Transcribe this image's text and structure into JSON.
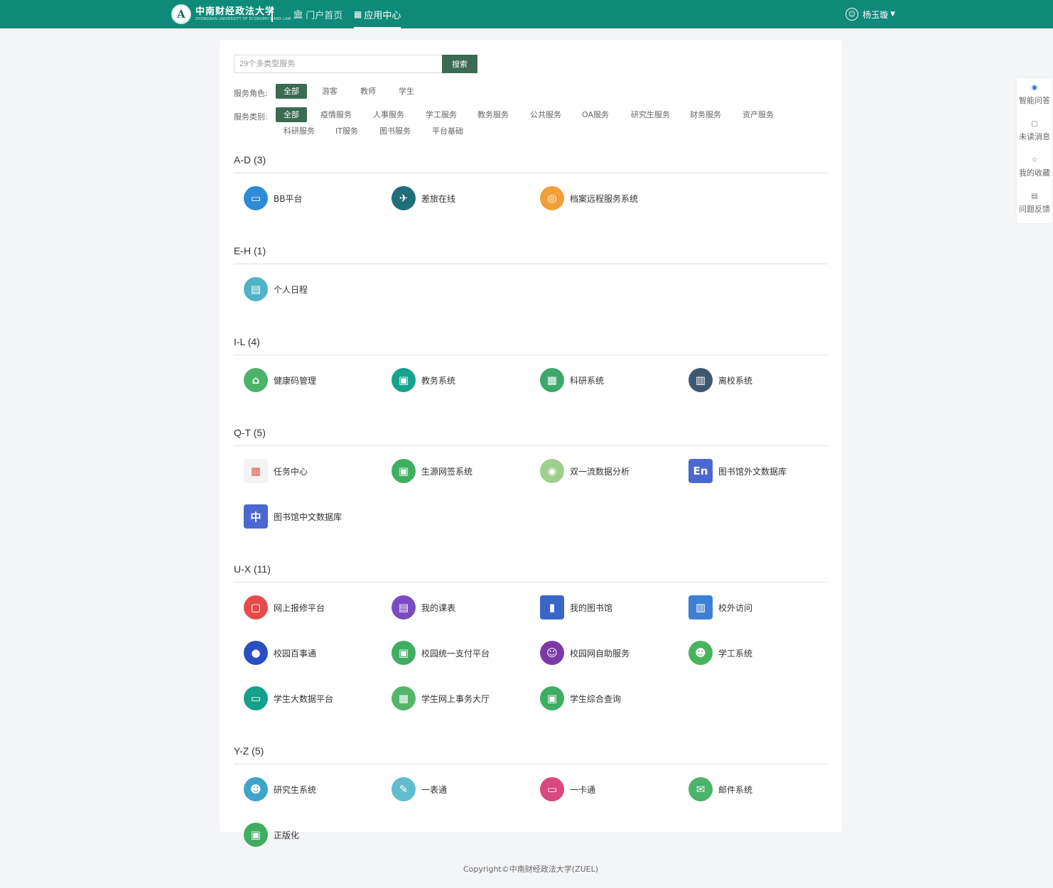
{
  "header": {
    "logo_cn": "中南财经政法大学",
    "logo_en": "ZHONGNAN UNIVERSITY OF ECONOMICS AND LAW",
    "nav": [
      {
        "label": "门户首页",
        "icon": "bank-icon"
      },
      {
        "label": "应用中心",
        "icon": "app-center-icon"
      }
    ],
    "user_name": "杨玉璇"
  },
  "search": {
    "placeholder": "29个多类型服务",
    "button": "搜索"
  },
  "filters": {
    "role_label": "服务角色:",
    "roles": [
      "全部",
      "游客",
      "教师",
      "学生"
    ],
    "category_label": "服务类别:",
    "categories": [
      "全部",
      "疫情服务",
      "人事服务",
      "学工服务",
      "教务服务",
      "公共服务",
      "OA服务",
      "研究生服务",
      "财务服务",
      "资产服务",
      "科研服务",
      "IT服务",
      "图书服务",
      "平台基础"
    ]
  },
  "sections": [
    {
      "title": "A-D (3)",
      "apps": [
        {
          "name": "BB平台",
          "color": "#2e8bd6",
          "glyph": "▭"
        },
        {
          "name": "差旅在线",
          "color": "#1f6e7a",
          "glyph": "✈"
        },
        {
          "name": "档案远程服务系统",
          "color": "#f2a03a",
          "glyph": "◎"
        }
      ]
    },
    {
      "title": "E-H (1)",
      "apps": [
        {
          "name": "个人日程",
          "color": "#4fb3c8",
          "glyph": "▤"
        }
      ]
    },
    {
      "title": "I-L (4)",
      "apps": [
        {
          "name": "健康码管理",
          "color": "#4cb36a",
          "glyph": "⌂"
        },
        {
          "name": "教务系统",
          "color": "#16a38c",
          "glyph": "▣"
        },
        {
          "name": "科研系统",
          "color": "#3ea86a",
          "glyph": "▦"
        },
        {
          "name": "离校系统",
          "color": "#3f5872",
          "glyph": "▥"
        }
      ]
    },
    {
      "title": "Q-T (5)",
      "apps": [
        {
          "name": "任务中心",
          "color": "#f3f3f3",
          "glyph": "▦",
          "square": true,
          "fg": "#e0574b"
        },
        {
          "name": "生源网签系统",
          "color": "#3fae62",
          "glyph": "▣"
        },
        {
          "name": "双一流数据分析",
          "color": "#9fcf8c",
          "glyph": "◉"
        },
        {
          "name": "图书馆外文数据库",
          "color": "#4b67d1",
          "glyph": "En",
          "square": true
        },
        {
          "name": "图书馆中文数据库",
          "color": "#4b67d1",
          "glyph": "中",
          "square": true
        }
      ]
    },
    {
      "title": "U-X (11)",
      "apps": [
        {
          "name": "网上报修平台",
          "color": "#e54b4b",
          "glyph": "▢"
        },
        {
          "name": "我的课表",
          "color": "#7a4bc1",
          "glyph": "▤"
        },
        {
          "name": "我的图书馆",
          "color": "#3a66c8",
          "glyph": "▮",
          "square": true
        },
        {
          "name": "校外访问",
          "color": "#3f7fd4",
          "glyph": "▥",
          "square": true
        },
        {
          "name": "校园百事通",
          "color": "#2b4fc2",
          "glyph": "●"
        },
        {
          "name": "校园统一支付平台",
          "color": "#3fae62",
          "glyph": "▣"
        },
        {
          "name": "校园网自助服务",
          "color": "#7c3aa6",
          "glyph": "☺"
        },
        {
          "name": "学工系统",
          "color": "#48b35e",
          "glyph": "☻"
        },
        {
          "name": "学生大数据平台",
          "color": "#14a08b",
          "glyph": "▭"
        },
        {
          "name": "学生网上事务大厅",
          "color": "#54b56a",
          "glyph": "▦"
        },
        {
          "name": "学生综合查询",
          "color": "#3fae62",
          "glyph": "▣"
        }
      ]
    },
    {
      "title": "Y-Z (5)",
      "apps": [
        {
          "name": "研究生系统",
          "color": "#3fa4c9",
          "glyph": "☻"
        },
        {
          "name": "一表通",
          "color": "#62bcd0",
          "glyph": "✎"
        },
        {
          "name": "一卡通",
          "color": "#d9487e",
          "glyph": "▭"
        },
        {
          "name": "邮件系统",
          "color": "#4cb36a",
          "glyph": "✉"
        },
        {
          "name": "正版化",
          "color": "#3fae62",
          "glyph": "▣"
        }
      ]
    }
  ],
  "sidebar": [
    {
      "label": "智能问答",
      "icon": "eye-icon",
      "glyph": "◉"
    },
    {
      "label": "未读消息",
      "icon": "message-icon",
      "glyph": "▢"
    },
    {
      "label": "我的收藏",
      "icon": "star-icon",
      "glyph": "☆"
    },
    {
      "label": "问题反馈",
      "icon": "feedback-icon",
      "glyph": "▤"
    }
  ],
  "footer": "Copyright©中南财经政法大学(ZUEL)",
  "colors": {
    "header": "#0e8a78",
    "accent": "#3b6b52"
  }
}
